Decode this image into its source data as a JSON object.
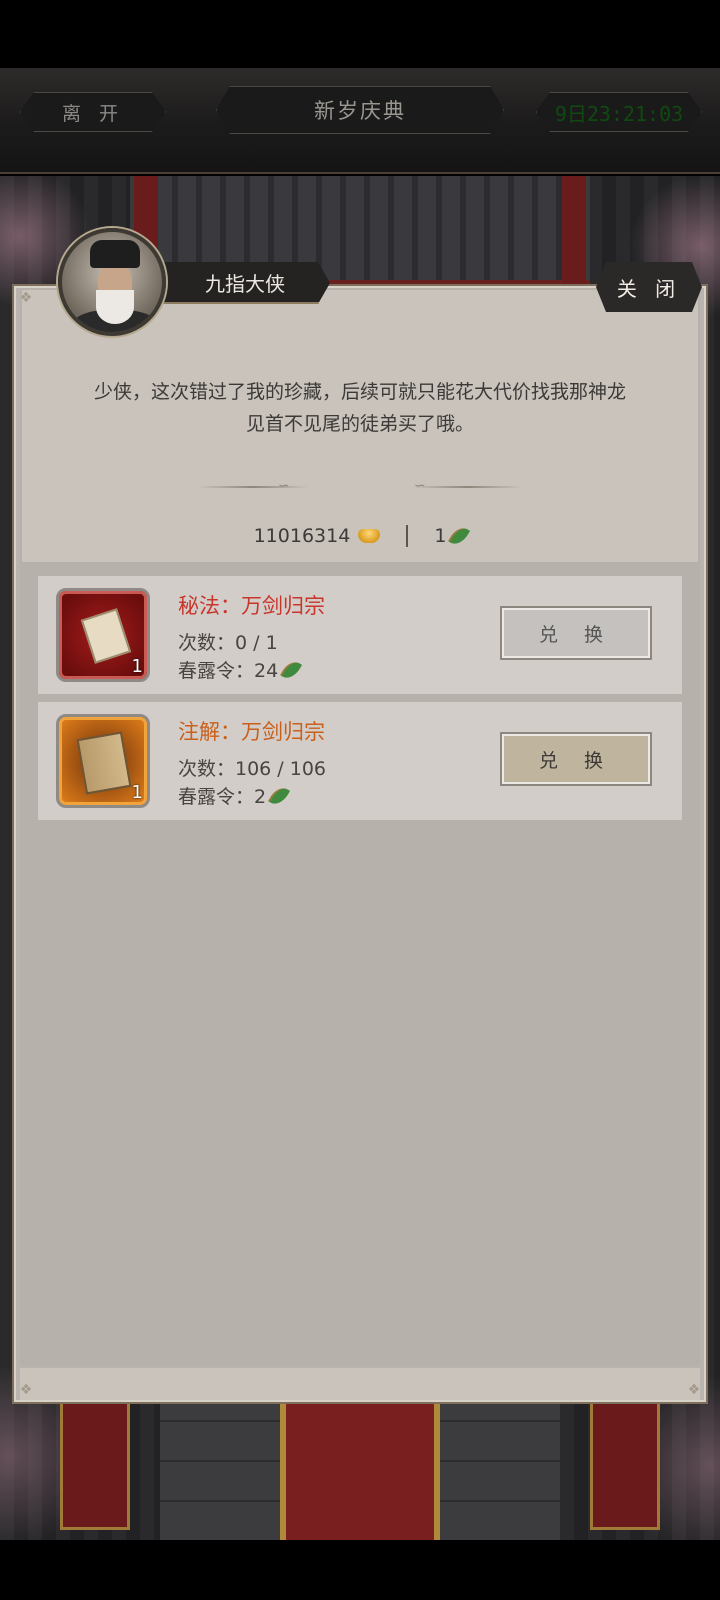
{
  "header": {
    "leave_label": "离 开",
    "title": "新岁庆典",
    "timer": "9日23:21:03"
  },
  "npc": {
    "name": "九指大侠",
    "close_label": "关 闭",
    "dialog_line1": "少侠，这次错过了我的珍藏，后续可就只能花大代价找我那神龙",
    "dialog_line2": "见首不见尾的徒弟买了哦。"
  },
  "currency": {
    "gold": "11016314",
    "gold_icon": "gold-ingot-icon",
    "token": "1",
    "token_icon": "leaf-token-icon"
  },
  "items": [
    {
      "title": "秘法：万剑归宗",
      "title_color": "#c8352b",
      "icon": "scroll-book-icon",
      "quantity": "1",
      "count_text": "次数：0 / 1",
      "cost_text": "春露令：24",
      "button_label": "兑 换",
      "button_state": "disabled"
    },
    {
      "title": "注解：万剑归宗",
      "title_color": "#c95f1a",
      "icon": "old-book-icon",
      "quantity": "1",
      "count_text": "次数：106 / 106",
      "cost_text": "春露令：2",
      "button_label": "兑 换",
      "button_state": "active"
    }
  ]
}
